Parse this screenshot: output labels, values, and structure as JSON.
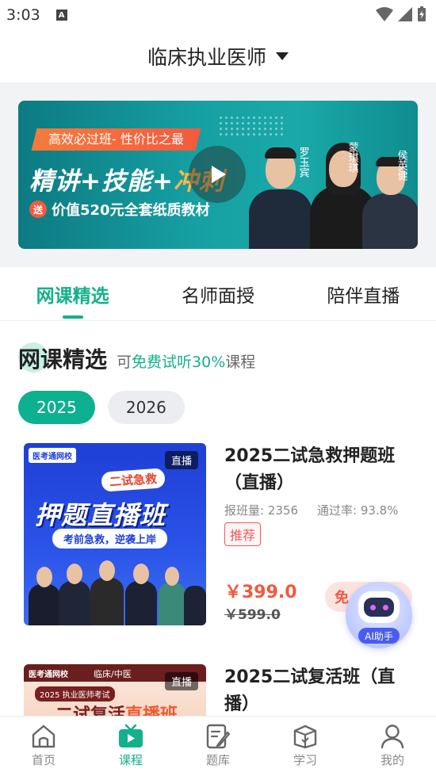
{
  "status_bar": {
    "time": "3:03",
    "notification_letter": "A"
  },
  "header": {
    "title": "临床执业医师"
  },
  "banner": {
    "tag": "高效必过班- 性价比之最",
    "headline_part1": "精讲+技能+",
    "headline_part2": "冲刺",
    "send_badge": "送",
    "subline": "价值520元全套纸质教材",
    "teachers": [
      "罗玉宾",
      "蒙琪琪",
      "侯英健"
    ]
  },
  "tabs": [
    {
      "label": "网课精选",
      "active": true
    },
    {
      "label": "名师面授",
      "active": false
    },
    {
      "label": "陪伴直播",
      "active": false
    }
  ],
  "section": {
    "title": "网课精选",
    "sub_prefix": "可",
    "sub_highlight": "免费试听30%",
    "sub_suffix": "课程"
  },
  "years": [
    {
      "label": "2025",
      "active": true
    },
    {
      "label": "2026",
      "active": false
    }
  ],
  "courses": [
    {
      "title": "2025二试急救押题班（直播）",
      "enrolled": "报班量: 2356",
      "pass_rate": "通过率: 93.8%",
      "tag": "推荐",
      "price": "￥399.0",
      "original_price": "￥599.0",
      "free_button": "免",
      "thumb": {
        "live": "直播",
        "brand": "医考通网校",
        "badge": "二试急救",
        "big": "押题直播班",
        "slogan": "考前急救，逆袭上岸"
      }
    },
    {
      "title": "2025二试复活班（直播）",
      "thumb": {
        "live": "直播",
        "brand": "医考通网校",
        "top_right": "临床/中医",
        "strip": "2025 执业医师考试",
        "big_a": "二试复活",
        "big_b": "直播班"
      }
    }
  ],
  "ai_assistant": {
    "label": "AI助手"
  },
  "bottom_nav": [
    {
      "label": "首页",
      "icon": "home-icon",
      "active": false
    },
    {
      "label": "课程",
      "icon": "tv-icon",
      "active": true
    },
    {
      "label": "题库",
      "icon": "notebook-icon",
      "active": false
    },
    {
      "label": "学习",
      "icon": "box-icon",
      "active": false
    },
    {
      "label": "我的",
      "icon": "user-icon",
      "active": false
    }
  ]
}
